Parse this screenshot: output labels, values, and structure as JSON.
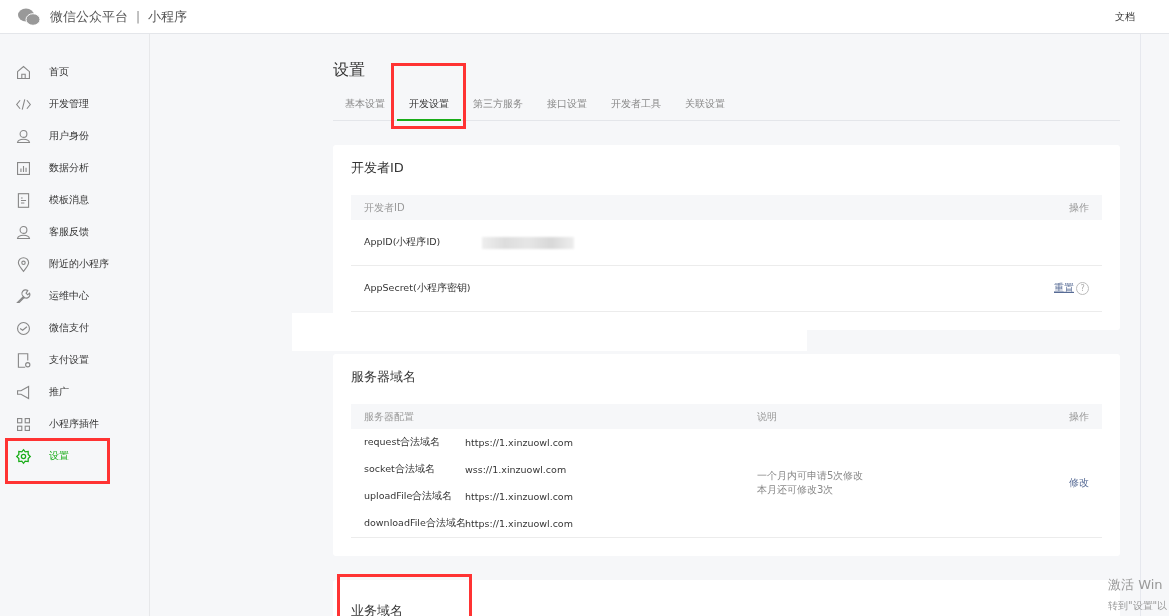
{
  "header": {
    "brand": "微信公众平台",
    "divider": "|",
    "product": "小程序",
    "links": [
      "文档"
    ]
  },
  "sidebar": {
    "items": [
      {
        "kind": "home",
        "label": "首页",
        "selected": false,
        "highlighted": false
      },
      {
        "kind": "code",
        "label": "开发管理",
        "selected": false,
        "highlighted": false
      },
      {
        "kind": "user",
        "label": "用户身份",
        "selected": false,
        "highlighted": false
      },
      {
        "kind": "chart",
        "label": "数据分析",
        "selected": false,
        "highlighted": false
      },
      {
        "kind": "doc",
        "label": "模板消息",
        "selected": false,
        "highlighted": false
      },
      {
        "kind": "user",
        "label": "客服反馈",
        "selected": false,
        "highlighted": false
      },
      {
        "kind": "pin",
        "label": "附近的小程序",
        "selected": false,
        "highlighted": false
      },
      {
        "kind": "wrench",
        "label": "运维中心",
        "selected": false,
        "highlighted": false
      },
      {
        "kind": "pay",
        "label": "微信支付",
        "selected": false,
        "highlighted": false
      },
      {
        "kind": "paydoc",
        "label": "支付设置",
        "selected": false,
        "highlighted": false
      },
      {
        "kind": "horn",
        "label": "推广",
        "selected": false,
        "highlighted": false
      },
      {
        "kind": "grid",
        "label": "小程序插件",
        "selected": false,
        "highlighted": false
      },
      {
        "kind": "gear",
        "label": "设置",
        "selected": true,
        "highlighted": true
      }
    ]
  },
  "page_title": "设置",
  "tabs": [
    {
      "label": "基本设置",
      "selected": false,
      "highlighted": false
    },
    {
      "label": "开发设置",
      "selected": true,
      "highlighted": true
    },
    {
      "label": "第三方服务",
      "selected": false,
      "highlighted": false
    },
    {
      "label": "接口设置",
      "selected": false,
      "highlighted": false
    },
    {
      "label": "开发者工具",
      "selected": false,
      "highlighted": false
    },
    {
      "label": "关联设置",
      "selected": false,
      "highlighted": false
    }
  ],
  "developer_id": {
    "title": "开发者ID",
    "columns": [
      "开发者ID",
      "操作"
    ],
    "rows": [
      {
        "label": "AppID(小程序ID)",
        "value_blurred": true
      },
      {
        "label": "AppSecret(小程序密钥)",
        "action": "重置",
        "help": "?"
      }
    ]
  },
  "server_domains": {
    "title": "服务器域名",
    "columns": [
      "服务器配置",
      "说明",
      "操作"
    ],
    "rows": [
      {
        "label": "request合法域名",
        "url": "https://1.xinzuowl.com"
      },
      {
        "label": "socket合法域名",
        "url": "wss://1.xinzuowl.com"
      },
      {
        "label": "uploadFile合法域名",
        "url": "https://1.xinzuowl.com"
      },
      {
        "label": "downloadFile合法域名",
        "url": "https://1.xinzuowl.com"
      }
    ],
    "notes": [
      "一个月内可申请5次修改",
      "本月还可修改3次"
    ],
    "action": "修改"
  },
  "business_domain": {
    "title": "业务域名",
    "highlighted": true
  },
  "os_notice": {
    "title": "激活 Win",
    "subtitle": "转到\"设置\"以"
  }
}
